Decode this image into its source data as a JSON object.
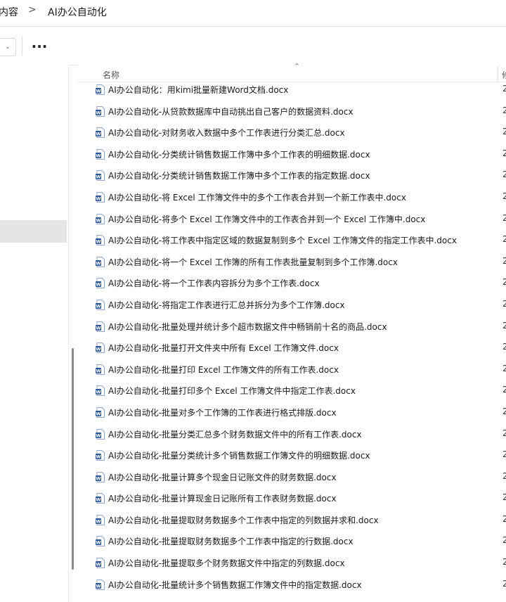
{
  "breadcrumb": {
    "items": [
      "内容",
      "AI办公自动化"
    ],
    "separator": ">"
  },
  "toolbar": {
    "more_label": "...",
    "dropdown_icon": "chevron-down-icon"
  },
  "file_list": {
    "name_header": "名称",
    "next_header_partial": "修",
    "date_partial": "2",
    "icon": "word-doc-icon",
    "accent": "#2b579a",
    "rows": [
      "AI办公自动化：用kimi批量新建Word文档.docx",
      "AI办公自动化-从贷款数据库中自动挑出自己客户的数据资料.docx",
      "AI办公自动化-对财务收入数据中多个工作表进行分类汇总.docx",
      "AI办公自动化-分类统计销售数据工作簿中多个工作表的明细数据.docx",
      "AI办公自动化-分类统计销售数据工作簿中多个工作表的指定数据.docx",
      "AI办公自动化-将 Excel 工作簿文件中的多个工作表合并到一个新工作表中.docx",
      "AI办公自动化-将多个 Excel 工作簿文件中的工作表合并到一个 Excel 工作簿中.docx",
      "AI办公自动化-将工作表中指定区域的数据复制到多个 Excel 工作簿文件的指定工作表中.docx",
      "AI办公自动化-将一个 Excel 工作簿的所有工作表批量复制到多个工作簿.docx",
      "AI办公自动化-将一个工作表内容拆分为多个工作表.docx",
      "AI办公自动化-将指定工作表进行汇总并拆分为多个工作簿.docx",
      "AI办公自动化-批量处理并统计多个超市数据文件中畅销前十名的商品.docx",
      "AI办公自动化-批量打开文件夹中所有 Excel 工作簿文件.docx",
      "AI办公自动化-批量打印 Excel 工作簿文件的所有工作表.docx",
      "AI办公自动化-批量打印多个 Excel 工作簿文件中指定工作表.docx",
      "AI办公自动化-批量对多个工作簿的工作表进行格式排版.docx",
      "AI办公自动化-批量分类汇总多个财务数据文件中的所有工作表.docx",
      "AI办公自动化-批量分类统计多个销售数据工作簿文件的明细数据.docx",
      "AI办公自动化-批量计算多个现金日记账文件的财务数据.docx",
      "AI办公自动化-批量计算现金日记账所有工作表财务数据.docx",
      "AI办公自动化-批量提取财务数据多个工作表中指定的列数据并求和.docx",
      "AI办公自动化-批量提取财务数据多个工作表中指定的行数据.docx",
      "AI办公自动化-批量提取多个财务数据文件中指定的列数据.docx",
      "AI办公自动化-批量统计多个销售数据工作簿文件中的指定数据.docx"
    ]
  }
}
